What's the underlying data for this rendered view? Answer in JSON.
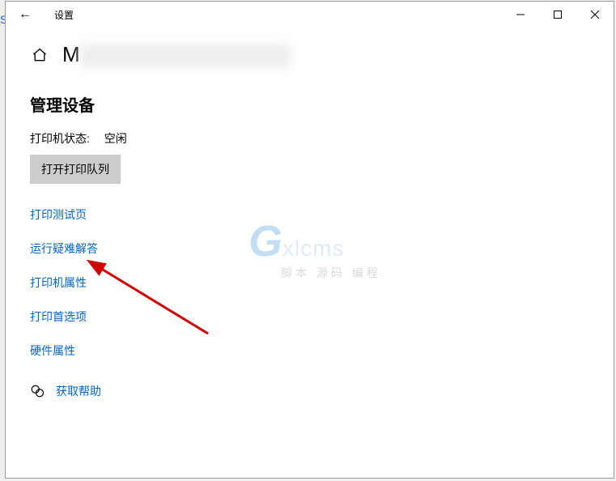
{
  "titlebar": {
    "app_title": "设置"
  },
  "header": {
    "device_prefix": "M"
  },
  "section": {
    "title": "管理设备",
    "status_label": "打印机状态:",
    "status_value": "空闲",
    "open_queue_button": "打开打印队列"
  },
  "links": {
    "print_test": "打印测试页",
    "troubleshoot": "运行疑难解答",
    "printer_properties": "打印机属性",
    "print_preferences": "打印首选项",
    "hardware_properties": "硬件属性",
    "get_help": "获取帮助"
  },
  "watermark": {
    "brand_g": "G",
    "brand_rest": "xlcms",
    "subtitle": "脚本 源码 编程"
  },
  "side_letter": "S"
}
